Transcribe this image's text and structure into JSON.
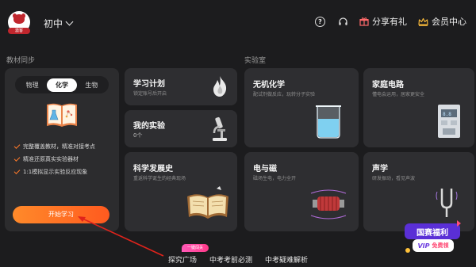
{
  "header": {
    "avatar_badge": "激客",
    "grade": "初中",
    "share": "分享有礼",
    "vip": "会员中心"
  },
  "sections": {
    "sync": "教材同步",
    "lab": "实验室"
  },
  "sync_card": {
    "subjects": [
      "物理",
      "化学",
      "生物"
    ],
    "active_subject": "化学",
    "features": [
      "完整覆盖教材，精准对接考点",
      "精准还原真实实验器材",
      "1:1模拟显示实验反应现象"
    ],
    "start_button": "开始学习"
  },
  "tiles": {
    "study_plan": {
      "title": "学习计划",
      "subtitle": "锁定账号后开启"
    },
    "my_experiments": {
      "title": "我的实验",
      "subtitle": "0个"
    },
    "science_history": {
      "title": "科学发展史",
      "subtitle": "重返科学诞生的经典现场"
    },
    "inorganic": {
      "title": "无机化学",
      "subtitle": "配试剂做反应，玩转分子实验"
    },
    "circuit": {
      "title": "家庭电路",
      "subtitle": "懂电会运用，居家更安全"
    },
    "electromagnetism": {
      "title": "电与磁",
      "subtitle": "磁场生电，电力全开"
    },
    "acoustics": {
      "title": "声学",
      "subtitle": "研发振动，看见声波"
    }
  },
  "bottom_nav": {
    "badge": "一键闯关",
    "items": [
      "探究广场",
      "中考考前必测",
      "中考疑难解析"
    ]
  },
  "promo": {
    "line1": "国赛福利",
    "line2": "VIP",
    "line3": "免费领"
  },
  "colors": {
    "accent": "#ff6a22",
    "background": "#1c1c1e",
    "card": "#2c2c2e",
    "arrow": "#e0231b"
  }
}
